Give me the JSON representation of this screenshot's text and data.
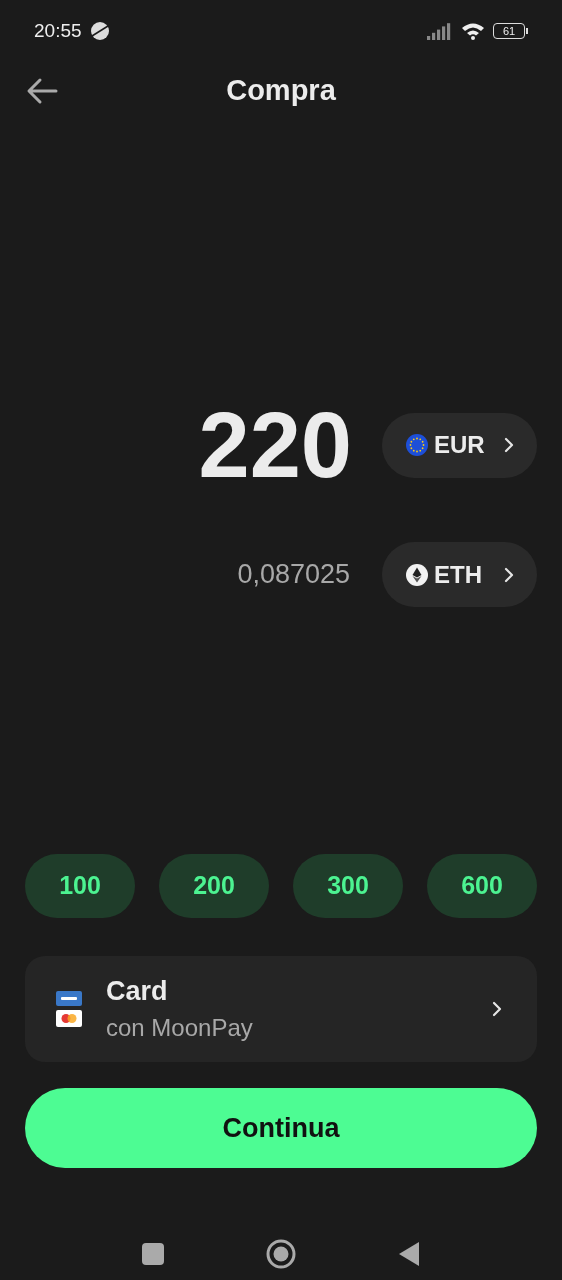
{
  "status_bar": {
    "time": "20:55",
    "battery": "61"
  },
  "header": {
    "title": "Compra"
  },
  "amount": {
    "value": "220",
    "currency": {
      "kind": "eur",
      "code": "EUR"
    }
  },
  "converted": {
    "value": "0,087025",
    "currency": {
      "kind": "eth",
      "code": "ETH"
    }
  },
  "quick_amounts": [
    "100",
    "200",
    "300",
    "600"
  ],
  "payment": {
    "title": "Card",
    "subtitle": "con MoonPay"
  },
  "continue_button": "Continua"
}
